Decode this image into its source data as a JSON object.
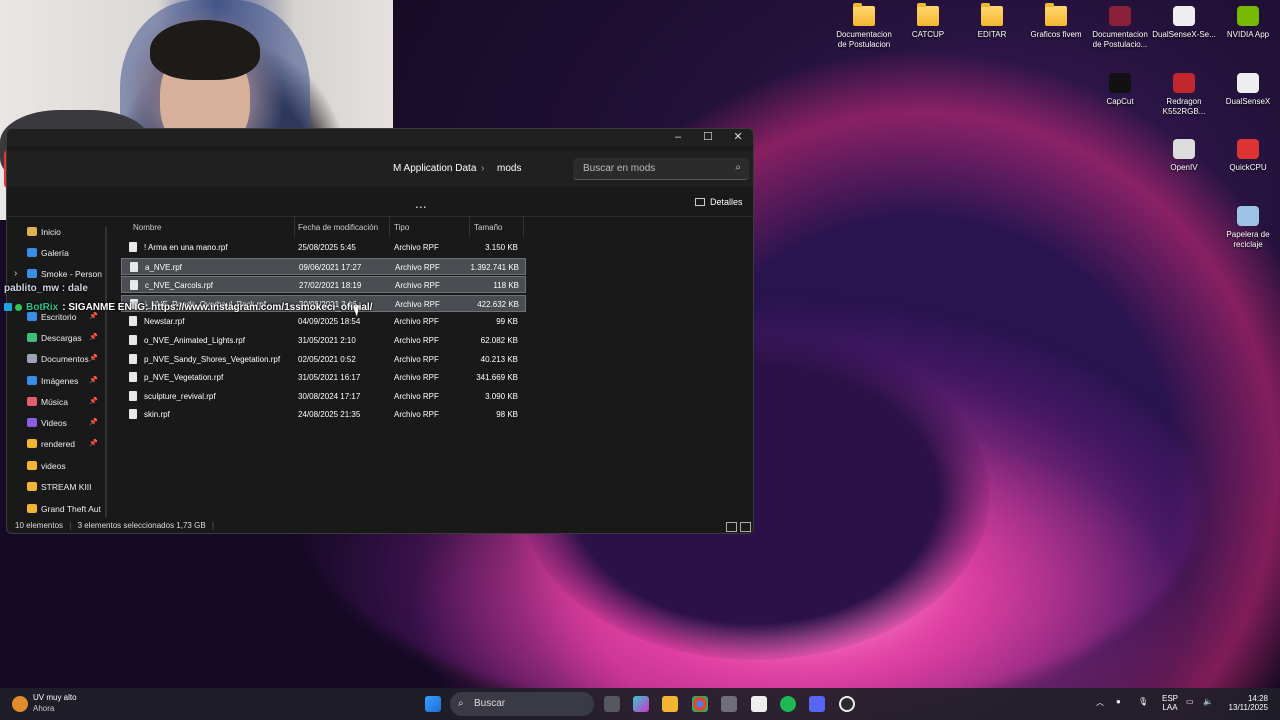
{
  "desktop": {
    "icons": [
      {
        "label": "Documentacion de Postulacion",
        "type": "folder"
      },
      {
        "label": "CATCUP",
        "type": "folder"
      },
      {
        "label": "EDITAR",
        "type": "folder"
      },
      {
        "label": "Graficos fivem",
        "type": "folder"
      },
      {
        "label": "Documentacion de Postulacio...",
        "type": "app",
        "icon": "winrar-icon"
      },
      {
        "label": "DualSenseX-Se...",
        "type": "app",
        "icon": "dualsensex-icon"
      },
      {
        "label": "NVIDIA App",
        "type": "app",
        "icon": "nvidia-icon"
      },
      {
        "label": "CapCut",
        "type": "app",
        "icon": "capcut-icon"
      },
      {
        "label": "Redragon K552RGB...",
        "type": "app",
        "icon": "redragon-icon"
      },
      {
        "label": "DualSenseX",
        "type": "app",
        "icon": "dualsensex-icon"
      },
      {
        "label": "OpenIV",
        "type": "app",
        "icon": "openiv-icon"
      },
      {
        "label": "QuickCPU",
        "type": "app",
        "icon": "quickcpu-icon"
      },
      {
        "label": "Papelera de reciclaje",
        "type": "app",
        "icon": "recycle-bin-icon"
      }
    ]
  },
  "overlay": {
    "chat_user": "pablito_mw : dale",
    "bot_name": "BotRix",
    "bot_message": ": SIGANME EN IG: https://www.instagram.com/1ssmokeci_oficial/"
  },
  "explorer": {
    "breadcrumb": [
      "M Application Data",
      "mods"
    ],
    "search_placeholder": "Buscar en mods",
    "toolbar_more": "...",
    "details_label": "Detalles",
    "columns": {
      "name": "Nombre",
      "date": "Fecha de modificación",
      "type": "Tipo",
      "size": "Tamaño"
    },
    "sidebar": [
      {
        "label": "Inicio",
        "icon": "home-icon",
        "pinned": false
      },
      {
        "label": "Galería",
        "icon": "gallery-icon",
        "pinned": false
      },
      {
        "label": "Smoke - Person",
        "icon": "onedrive-icon",
        "pinned": false
      },
      {
        "label": "Escritorio",
        "icon": "desktop-icon",
        "pinned": true
      },
      {
        "label": "Descargas",
        "icon": "download-icon",
        "pinned": true
      },
      {
        "label": "Documentos",
        "icon": "documents-icon",
        "pinned": true
      },
      {
        "label": "Imágenes",
        "icon": "images-icon",
        "pinned": true
      },
      {
        "label": "Música",
        "icon": "music-icon",
        "pinned": true
      },
      {
        "label": "Videos",
        "icon": "videos-icon",
        "pinned": true
      },
      {
        "label": "rendered",
        "icon": "folder-icon",
        "pinned": true
      },
      {
        "label": "videos",
        "icon": "folder-icon",
        "pinned": false
      },
      {
        "label": "STREAM KIII",
        "icon": "folder-icon",
        "pinned": false
      },
      {
        "label": "Grand Theft Aut",
        "icon": "folder-icon",
        "pinned": false
      }
    ],
    "files": [
      {
        "name": "! Arma en una mano.rpf",
        "date": "25/08/2025 5:45",
        "type": "Archivo RPF",
        "size": "3.150 KB",
        "selected": false
      },
      {
        "name": "a_NVE.rpf",
        "date": "09/06/2021 17:27",
        "type": "Archivo RPF",
        "size": "1.392.741 KB",
        "selected": true
      },
      {
        "name": "c_NVE_Carcols.rpf",
        "date": "27/02/2021 18:19",
        "type": "Archivo RPF",
        "size": "118 KB",
        "selected": true
      },
      {
        "name": "i_NVE_Roads_Overhaul_Pack.rpf",
        "date": "30/05/2021 3:16",
        "type": "Archivo RPF",
        "size": "422.632 KB",
        "selected": true
      },
      {
        "name": "Newstar.rpf",
        "date": "04/09/2025 18:54",
        "type": "Archivo RPF",
        "size": "99 KB",
        "selected": false
      },
      {
        "name": "o_NVE_Animated_Lights.rpf",
        "date": "31/05/2021 2:10",
        "type": "Archivo RPF",
        "size": "62.082 KB",
        "selected": false
      },
      {
        "name": "p_NVE_Sandy_Shores_Vegetation.rpf",
        "date": "02/05/2021 0:52",
        "type": "Archivo RPF",
        "size": "40.213 KB",
        "selected": false
      },
      {
        "name": "p_NVE_Vegetation.rpf",
        "date": "31/05/2021 16:17",
        "type": "Archivo RPF",
        "size": "341.669 KB",
        "selected": false
      },
      {
        "name": "sculpture_revival.rpf",
        "date": "30/08/2024 17:17",
        "type": "Archivo RPF",
        "size": "3.090 KB",
        "selected": false
      },
      {
        "name": "skin.rpf",
        "date": "24/08/2025 21:35",
        "type": "Archivo RPF",
        "size": "98 KB",
        "selected": false
      }
    ],
    "status": {
      "count": "10 elementos",
      "selection": "3 elementos seleccionados 1,73 GB"
    }
  },
  "taskbar": {
    "weather_title": "UV muy alto",
    "weather_sub": "Ahora",
    "search_label": "Buscar",
    "lang_top": "ESP",
    "lang_bottom": "LAA",
    "time": "14:28",
    "date": "13/11/2025"
  },
  "colors": {
    "selection": "#4a4d51",
    "window_bg": "#191919",
    "folder": "#f2b632"
  }
}
